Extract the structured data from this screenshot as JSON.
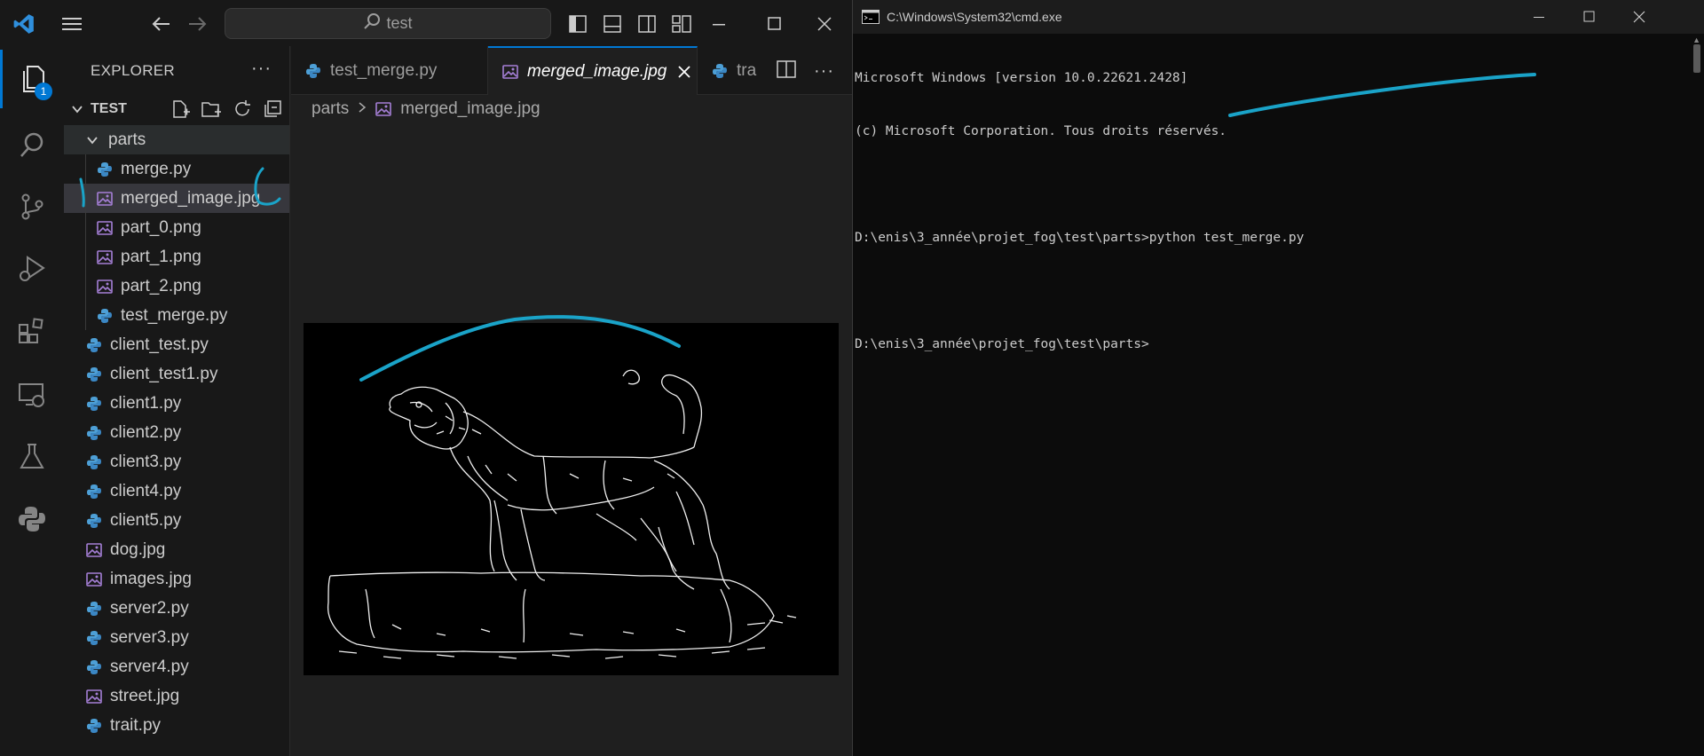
{
  "vscode": {
    "search_text": "test",
    "explorer_title": "EXPLORER",
    "folder_name": "TEST",
    "badge_count": "1",
    "tree": [
      {
        "label": "parts",
        "type": "folder"
      },
      {
        "label": "merge.py",
        "type": "python"
      },
      {
        "label": "merged_image.jpg",
        "type": "image"
      },
      {
        "label": "part_0.png",
        "type": "image"
      },
      {
        "label": "part_1.png",
        "type": "image"
      },
      {
        "label": "part_2.png",
        "type": "image"
      },
      {
        "label": "test_merge.py",
        "type": "python"
      },
      {
        "label": "client_test.py",
        "type": "python"
      },
      {
        "label": "client_test1.py",
        "type": "python"
      },
      {
        "label": "client1.py",
        "type": "python"
      },
      {
        "label": "client2.py",
        "type": "python"
      },
      {
        "label": "client3.py",
        "type": "python"
      },
      {
        "label": "client4.py",
        "type": "python"
      },
      {
        "label": "client5.py",
        "type": "python"
      },
      {
        "label": "dog.jpg",
        "type": "image"
      },
      {
        "label": "images.jpg",
        "type": "image"
      },
      {
        "label": "server2.py",
        "type": "python"
      },
      {
        "label": "server3.py",
        "type": "python"
      },
      {
        "label": "server4.py",
        "type": "python"
      },
      {
        "label": "street.jpg",
        "type": "image"
      },
      {
        "label": "trait.py",
        "type": "python"
      }
    ],
    "tabs": [
      {
        "label": "test_merge.py",
        "type": "python"
      },
      {
        "label": "merged_image.jpg",
        "type": "image"
      },
      {
        "label": "tra",
        "type": "python"
      }
    ],
    "breadcrumb": {
      "folder": "parts",
      "file": "merged_image.jpg"
    }
  },
  "cmd": {
    "title": "C:\\Windows\\System32\\cmd.exe",
    "lines": [
      "Microsoft Windows [version 10.0.22621.2428]",
      "(c) Microsoft Corporation. Tous droits réservés.",
      "",
      "D:\\enis\\3_année\\projet_fog\\test\\parts>python test_merge.py",
      "",
      "D:\\enis\\3_année\\projet_fog\\test\\parts>"
    ]
  },
  "colors": {
    "accent": "#0078d4",
    "annotation": "#1aa3c8",
    "python_icon": "#4d9fd6",
    "image_icon": "#a57fd6"
  }
}
